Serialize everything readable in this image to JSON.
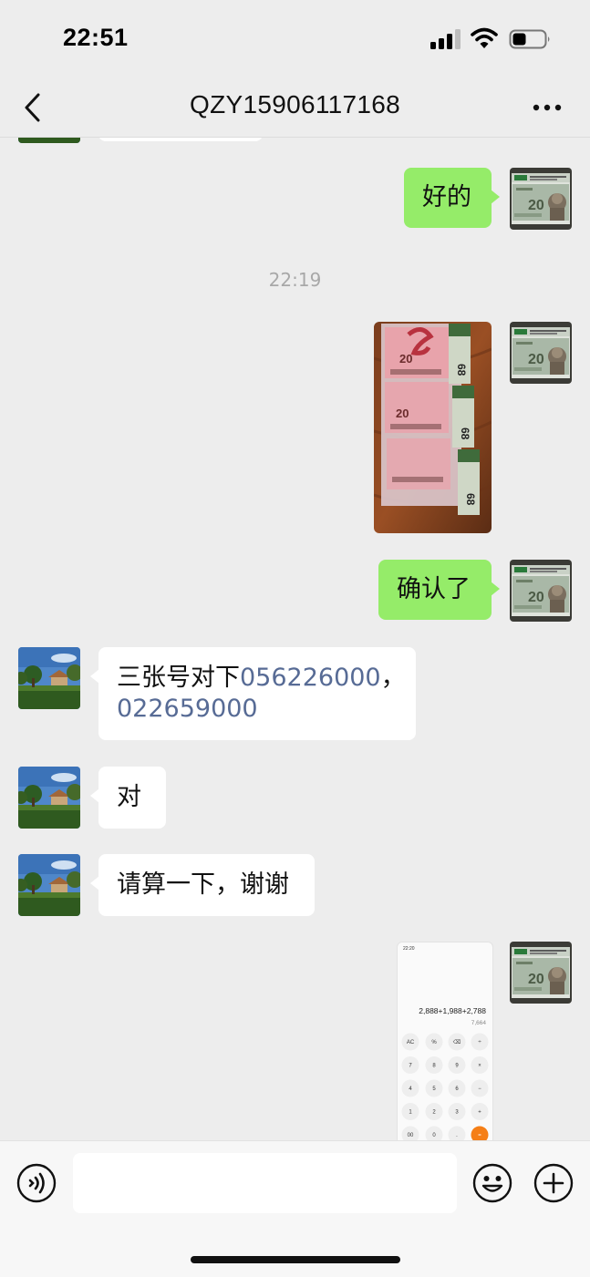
{
  "status": {
    "time": "22:51"
  },
  "header": {
    "title": "QZY15906117168"
  },
  "messages": {
    "m1": "好的",
    "timestamp": "22:19",
    "m2": "确认了",
    "m3_text": "三张号对下",
    "m3_num1": "056226000",
    "m3_sep": "，",
    "m3_num2": "022659000",
    "m4": "对",
    "m5": "请算一下，谢谢"
  },
  "calculator": {
    "time": "22:20",
    "expression": "2,888+1,988+2,788",
    "result": "7,664",
    "keys": [
      [
        "AC",
        "%",
        "⌫",
        "÷"
      ],
      [
        "7",
        "8",
        "9",
        "×"
      ],
      [
        "4",
        "5",
        "6",
        "−"
      ],
      [
        "1",
        "2",
        "3",
        "+"
      ],
      [
        "00",
        "0",
        ".",
        "="
      ]
    ]
  },
  "banknote": {
    "denomination": "20",
    "badge": "68",
    "strip_denom": "20"
  },
  "colors": {
    "green_bubble": "#95ec69",
    "link": "#576b95",
    "accent_orange": "#f57f17"
  },
  "icons": [
    "back-chevron-icon",
    "more-icon",
    "voice-icon",
    "emoji-icon",
    "plus-icon",
    "signal-icon",
    "wifi-icon",
    "battery-icon"
  ]
}
